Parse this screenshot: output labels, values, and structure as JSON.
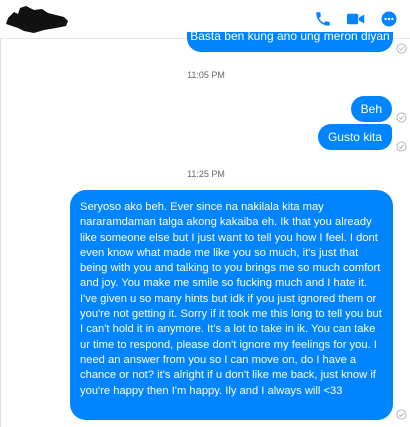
{
  "header": {
    "icons": [
      "phone-icon",
      "video-camera-icon",
      "info-icon"
    ],
    "accent_color": "#0084ff"
  },
  "messages": {
    "cut_message": "Basta ben kung ano ung meron diyan",
    "timestamp_1": "11:05 PM",
    "msg_beh": "Beh",
    "msg_gusto": "Gusto kita",
    "timestamp_2": "11:25 PM",
    "msg_long": "Seryoso ako beh. Ever since na nakilala kita may nararamdaman talga akong kakaiba eh. Ik that you already like someone else but I just want to tell you how I feel. I dont even know what made me like you so much, it's just that being with you and talking to you brings me so much comfort and joy. You make me smile so fucking much and I hate it. I've given u so many hints but idk if you just ignored them or you're not getting it. Sorry if it took me this long to tell you but I can't hold it in anymore. It's a lot to take in ik. You can take ur time to respond, please don't ignore my feelings for you. I need an answer from you so I can move on, do I have a chance or not? it's alright if u don't like me back, just know if you're happy then I'm happy. Ily and I always will <33"
  }
}
